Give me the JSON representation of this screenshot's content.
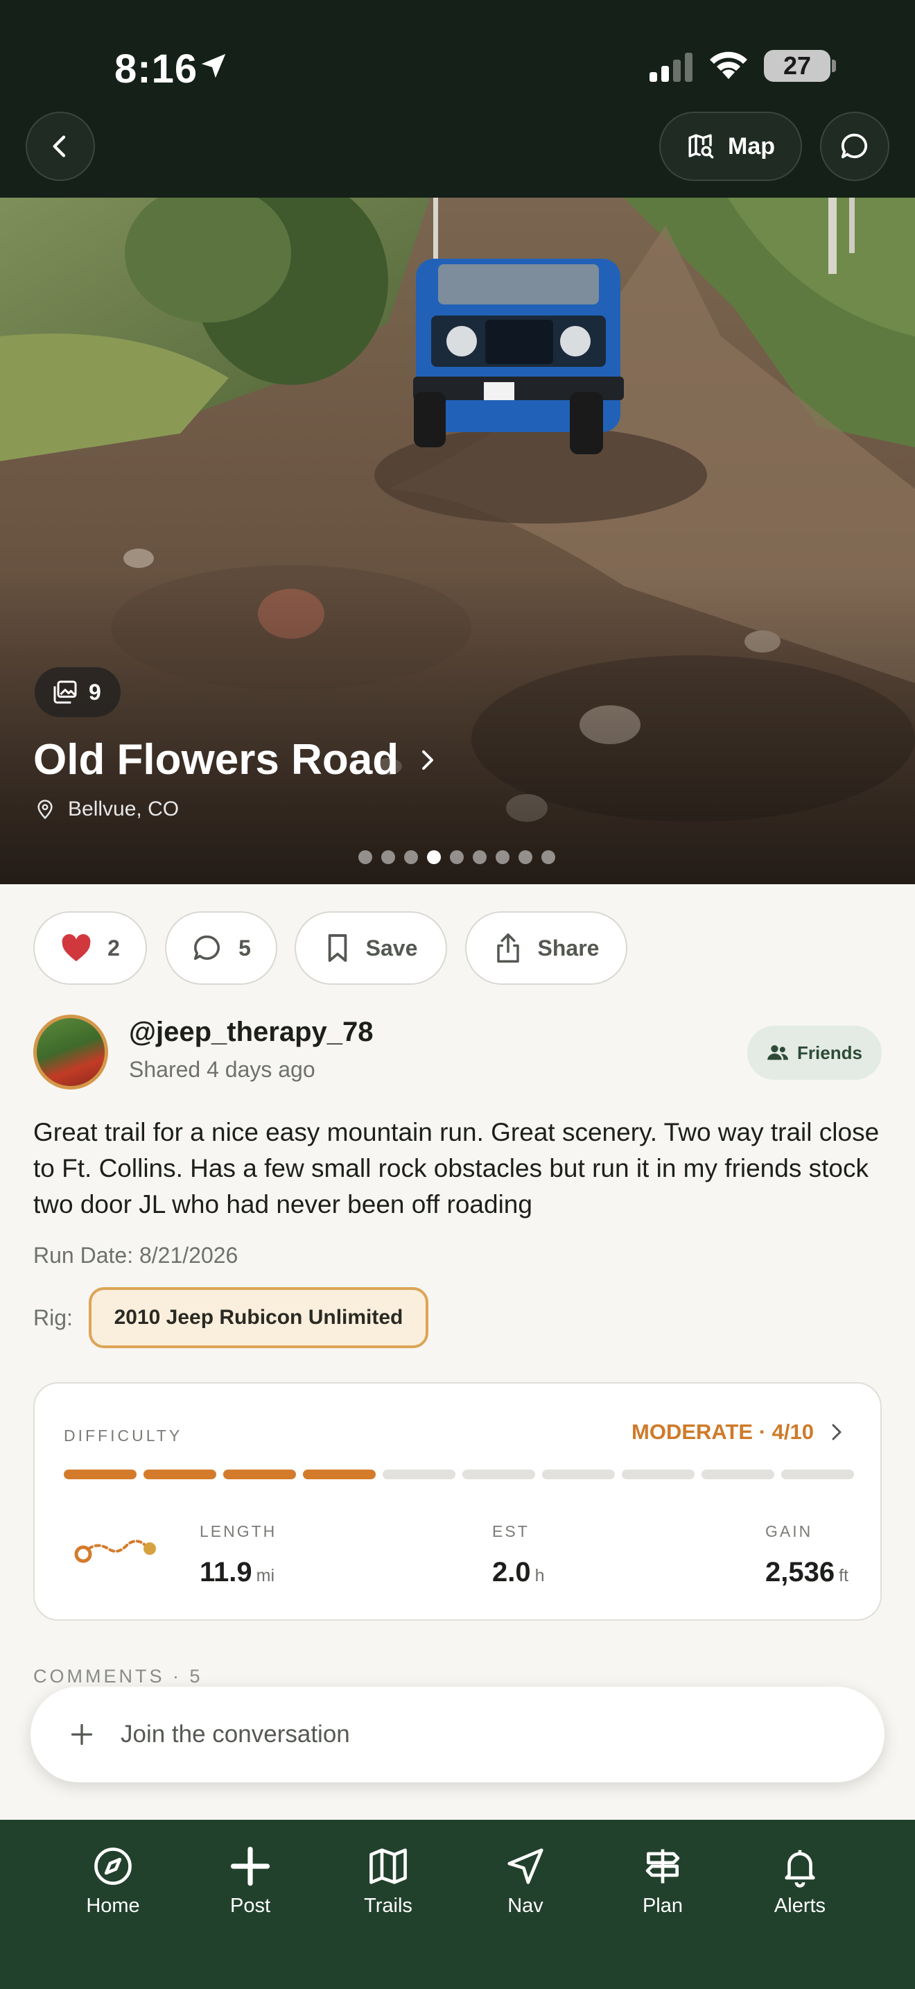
{
  "status": {
    "time": "8:16",
    "battery": "27"
  },
  "header": {
    "map_label": "Map"
  },
  "trail": {
    "photo_count": "9",
    "title": "Old Flowers Road",
    "location": "Bellvue, CO",
    "photo_total": 9,
    "photo_active_index": 3
  },
  "actions": {
    "likes": "2",
    "comments": "5",
    "save_label": "Save",
    "share_label": "Share"
  },
  "post": {
    "username": "@jeep_therapy_78",
    "shared": "Shared 4 days ago",
    "visibility": "Friends",
    "body": "Great trail for a nice easy mountain run. Great scenery. Two way trail close to Ft. Collins. Has a few small rock obstacles but run it in my friends stock two door JL who had never been off roading",
    "run_date": "Run Date: 8/21/2026",
    "rig_label": "Rig:",
    "rig": "2010 Jeep Rubicon Unlimited"
  },
  "difficulty": {
    "label": "DIFFICULTY",
    "value": "MODERATE · 4/10",
    "level": 4,
    "max": 10
  },
  "stats": {
    "length_label": "LENGTH",
    "length_value": "11.9",
    "length_unit": "mi",
    "est_label": "EST",
    "est_value": "2.0",
    "est_unit": "h",
    "gain_label": "GAIN",
    "gain_value": "2,536",
    "gain_unit": "ft"
  },
  "comments": {
    "header": "COMMENTS · 5",
    "placeholder": "Join the conversation"
  },
  "nav": {
    "home": "Home",
    "post": "Post",
    "trails": "Trails",
    "nav": "Nav",
    "plan": "Plan",
    "alerts": "Alerts"
  },
  "colors": {
    "accent": "#d47b2b",
    "nav_bg": "#21412c",
    "header_bg": "#142018"
  }
}
